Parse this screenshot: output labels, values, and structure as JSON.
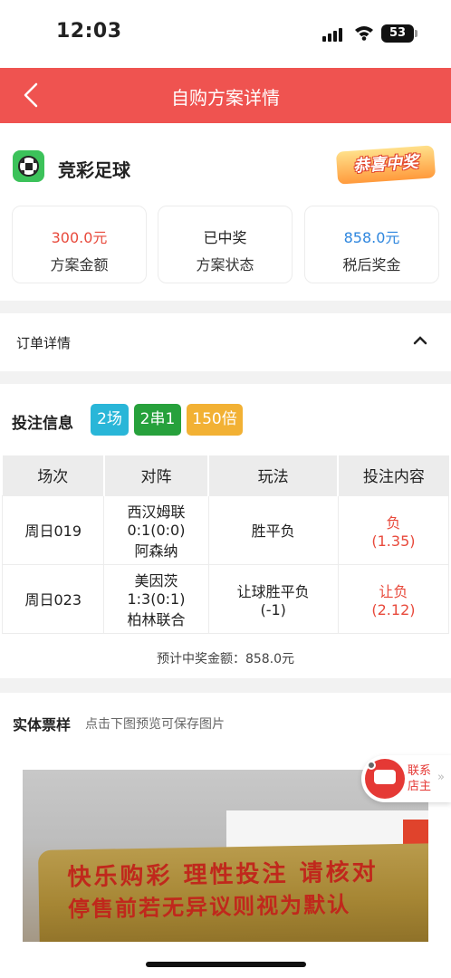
{
  "status_bar": {
    "time": "12:03",
    "battery": "53"
  },
  "nav": {
    "title": "自购方案详情"
  },
  "lottery": {
    "name": "竞彩足球",
    "win_badge": "恭喜中奖",
    "stats": [
      {
        "value": "300.0元",
        "label": "方案金额",
        "color": "#e84a3c"
      },
      {
        "value": "已中奖",
        "label": "方案状态",
        "color": "#222222"
      },
      {
        "value": "858.0元",
        "label": "税后奖金",
        "color": "#2e86de"
      }
    ]
  },
  "order": {
    "title": "订单详情"
  },
  "bet": {
    "label": "投注信息",
    "tags": [
      {
        "text": "2场",
        "color": "#29b6d8"
      },
      {
        "text": "2串1",
        "color": "#27a13c"
      },
      {
        "text": "150倍",
        "color": "#f2b134"
      }
    ],
    "columns": [
      "场次",
      "对阵",
      "玩法",
      "投注内容"
    ],
    "rows": [
      {
        "match_no": "周日019",
        "home": "西汉姆联",
        "score": "0:1(0:0)",
        "away": "阿森纳",
        "play_line1": "胜平负",
        "play_line2": "",
        "pick": "负",
        "odds": "(1.35)"
      },
      {
        "match_no": "周日023",
        "home": "美因茨",
        "score": "1:3(0:1)",
        "away": "柏林联合",
        "play_line1": "让球胜平负",
        "play_line2": "(-1)",
        "pick": "让负",
        "odds": "(2.12)"
      }
    ],
    "estimate": "预计中奖金额：858.0元"
  },
  "ticket": {
    "title": "实体票样",
    "hint": "点击下图预览可保存图片",
    "engrave_line1": "快乐购彩  理性投注  请核对",
    "engrave_line2": "停售前若无异议则视为默认"
  },
  "contact": {
    "label": "联系店主"
  }
}
